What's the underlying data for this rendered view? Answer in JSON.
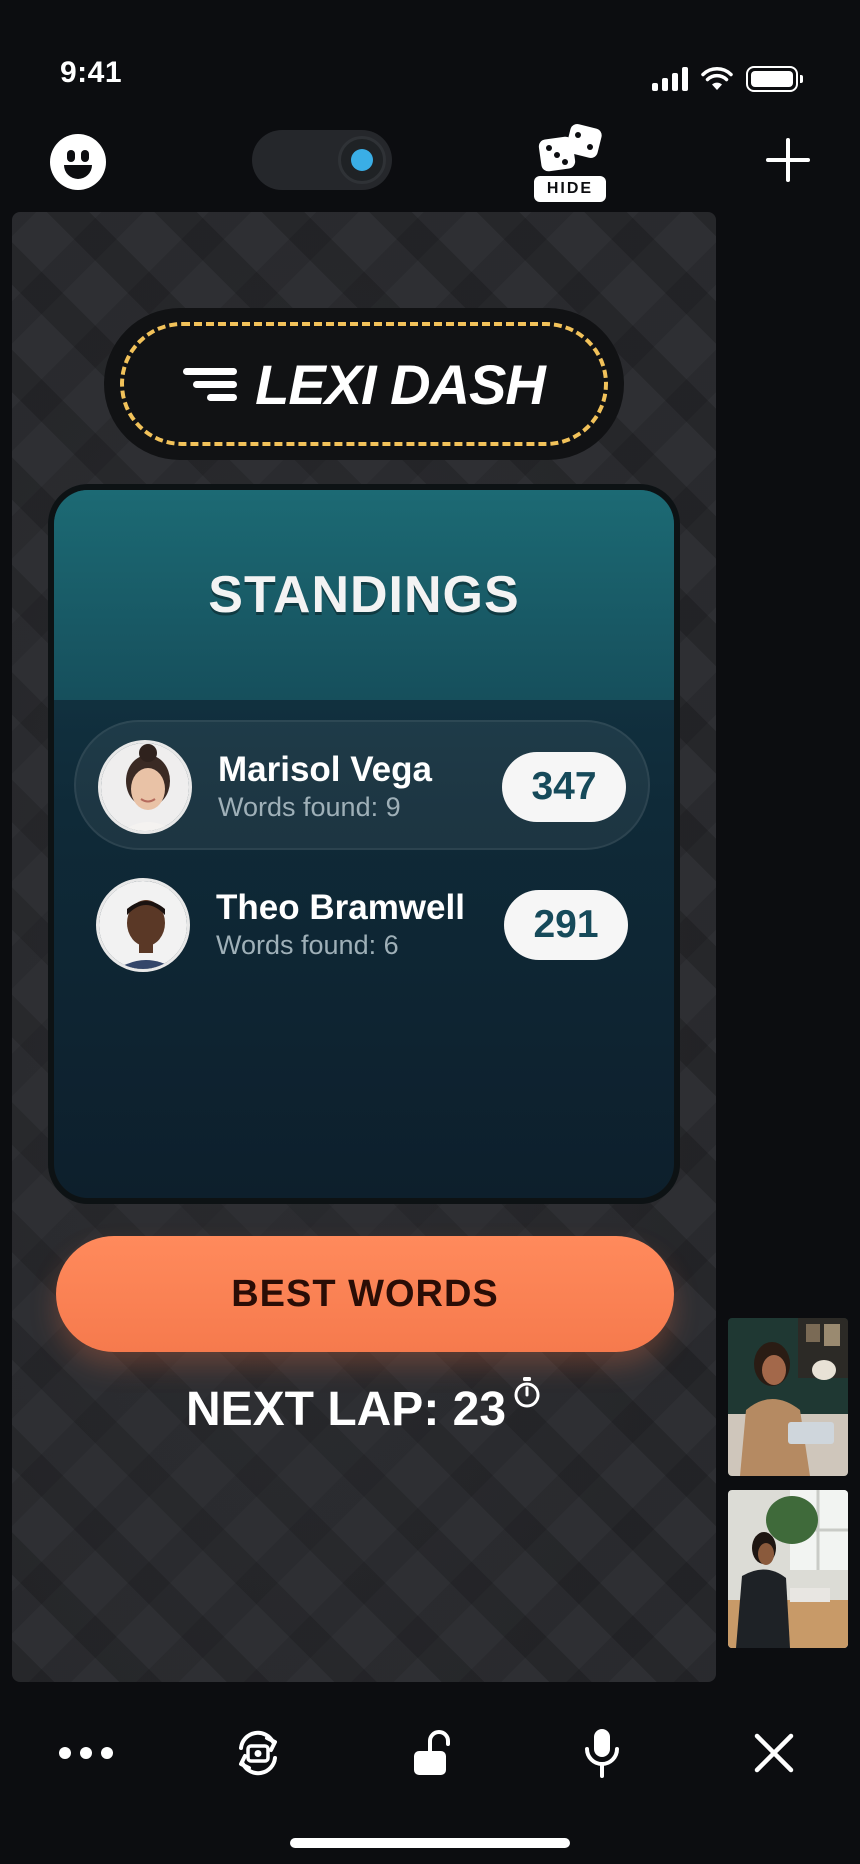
{
  "status_bar": {
    "time": "9:41"
  },
  "top_bar": {
    "hide_label": "HIDE"
  },
  "game": {
    "logo_text": "LEXI DASH",
    "standings_title": "STANDINGS",
    "players": [
      {
        "name": "Marisol Vega",
        "words_found": "Words found: 9",
        "score": "347",
        "highlighted": true
      },
      {
        "name": "Theo Bramwell",
        "words_found": "Words found: 6",
        "score": "291",
        "highlighted": false
      }
    ],
    "best_words_label": "BEST WORDS",
    "next_lap_label": "NEXT LAP: 23"
  },
  "icons": {
    "top": [
      "emoji-icon",
      "toggle-switch",
      "dice-icon",
      "plus-icon"
    ],
    "bottom": [
      "more-icon",
      "camera-flip-icon",
      "unlock-icon",
      "microphone-icon",
      "close-icon"
    ],
    "timer": "stopwatch-icon"
  },
  "colors": {
    "accent_orange": "#f67a4d",
    "logo_dash_yellow": "#f2c25a",
    "toggle_blue": "#3aaee6",
    "standings_teal": "#1c6a74"
  }
}
